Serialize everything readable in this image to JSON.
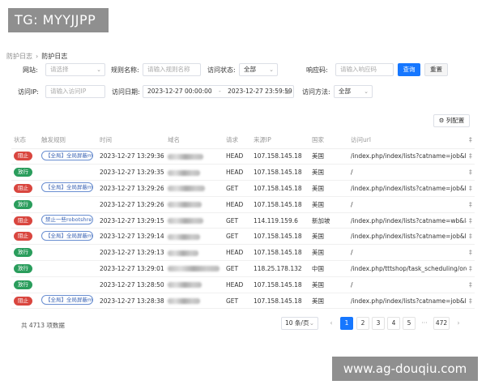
{
  "watermark_top": "TG: MYYJJPP",
  "watermark_bottom": "www.ag-douqiu.com",
  "breadcrumb": {
    "parent": "防护日志",
    "sep": "›",
    "current": "防护日志"
  },
  "filters": {
    "site_label": "网站:",
    "site_placeholder": "请选择",
    "rule_label": "规则名称:",
    "rule_placeholder": "请输入规则名称",
    "status_label": "访问状态:",
    "status_value": "全部",
    "code_label": "响应码:",
    "code_placeholder": "请输入响应码",
    "query_button": "查询",
    "reset_button": "重置",
    "ip_label": "访问IP:",
    "ip_placeholder": "请输入访问IP",
    "date_label": "访问日期:",
    "date_start": "2023-12-27 00:00:00",
    "date_sep": "-",
    "date_end": "2023-12-27 23:59:59",
    "method_label": "访问方法:",
    "method_value": "全部",
    "column_config": "列配置"
  },
  "table": {
    "headers": [
      "状态",
      "触发规则",
      "时间",
      "域名",
      "请求",
      "来源IP",
      "国家",
      "访问url"
    ],
    "rows": [
      {
        "status": "阻止",
        "type": "block",
        "rule": "【全局】全局屏蔽my-ti",
        "time": "2023-12-27 13:29:36",
        "method": "HEAD",
        "ip": "107.158.145.18",
        "country": "美国",
        "url": "/index.php/index/lists?catname=job&la"
      },
      {
        "status": "放行",
        "type": "pass",
        "rule": "",
        "time": "2023-12-27 13:29:35",
        "method": "HEAD",
        "ip": "107.158.145.18",
        "country": "美国",
        "url": "/"
      },
      {
        "status": "阻止",
        "type": "block",
        "rule": "【全局】全局屏蔽my-ti",
        "time": "2023-12-27 13:29:26",
        "method": "GET",
        "ip": "107.158.145.18",
        "country": "美国",
        "url": "/index.php/index/lists?catname=job&la"
      },
      {
        "status": "放行",
        "type": "pass",
        "rule": "",
        "time": "2023-12-27 13:29:26",
        "method": "HEAD",
        "ip": "107.158.145.18",
        "country": "美国",
        "url": "/"
      },
      {
        "status": "阻止",
        "type": "block",
        "rule": "禁止一些robotshrefs",
        "time": "2023-12-27 13:29:15",
        "method": "GET",
        "ip": "114.119.159.6",
        "country": "新加坡",
        "url": "/index.php/index/lists?catname=wb&la"
      },
      {
        "status": "阻止",
        "type": "block",
        "rule": "【全局】全局屏蔽my-ti",
        "time": "2023-12-27 13:29:14",
        "method": "GET",
        "ip": "107.158.145.18",
        "country": "美国",
        "url": "/index.php/index/lists?catname=job&la"
      },
      {
        "status": "放行",
        "type": "pass",
        "rule": "",
        "time": "2023-12-27 13:29:13",
        "method": "HEAD",
        "ip": "107.158.145.18",
        "country": "美国",
        "url": "/"
      },
      {
        "status": "放行",
        "type": "pass",
        "rule": "",
        "time": "2023-12-27 13:29:01",
        "method": "GET",
        "ip": "118.25.178.132",
        "country": "中国",
        "url": "/index.php/tttshop/task_scheduling/ord"
      },
      {
        "status": "放行",
        "type": "pass",
        "rule": "",
        "time": "2023-12-27 13:28:50",
        "method": "HEAD",
        "ip": "107.158.145.18",
        "country": "美国",
        "url": "/"
      },
      {
        "status": "阻止",
        "type": "block",
        "rule": "【全局】全局屏蔽my-ti",
        "time": "2023-12-27 13:28:38",
        "method": "GET",
        "ip": "107.158.145.18",
        "country": "美国",
        "url": "/index.php/index/lists?catname=job&la"
      }
    ]
  },
  "pagination": {
    "total": "共 4713 项数据",
    "page_size": "10 条/页",
    "prev": "‹",
    "next": "›",
    "ellipsis": "···",
    "pages": [
      "1",
      "2",
      "3",
      "4",
      "5"
    ],
    "last_page": "472",
    "current": "1"
  }
}
